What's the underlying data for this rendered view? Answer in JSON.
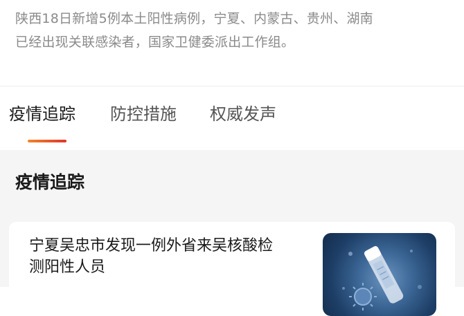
{
  "intro": {
    "line1": "陕西18日新增5例本土阳性病例，宁夏、内蒙古、贵州、湖南",
    "line2": "已经出现关联感染者，国家卫健委派出工作组。"
  },
  "tabs": [
    {
      "label": "疫情追踪",
      "active": true
    },
    {
      "label": "防控措施",
      "active": false
    },
    {
      "label": "权威发声",
      "active": false
    }
  ],
  "colors": {
    "tab_underline_start": "#f0862a",
    "tab_underline_end": "#e0342a",
    "page_background": "#f5f5f5"
  },
  "section": {
    "title": "疫情追踪"
  },
  "news": [
    {
      "title_line1": "宁夏吴忠市发现一例外省来吴核酸检",
      "title_line2": "测阳性人员",
      "thumbnail": "virus-test-tube-image"
    }
  ]
}
